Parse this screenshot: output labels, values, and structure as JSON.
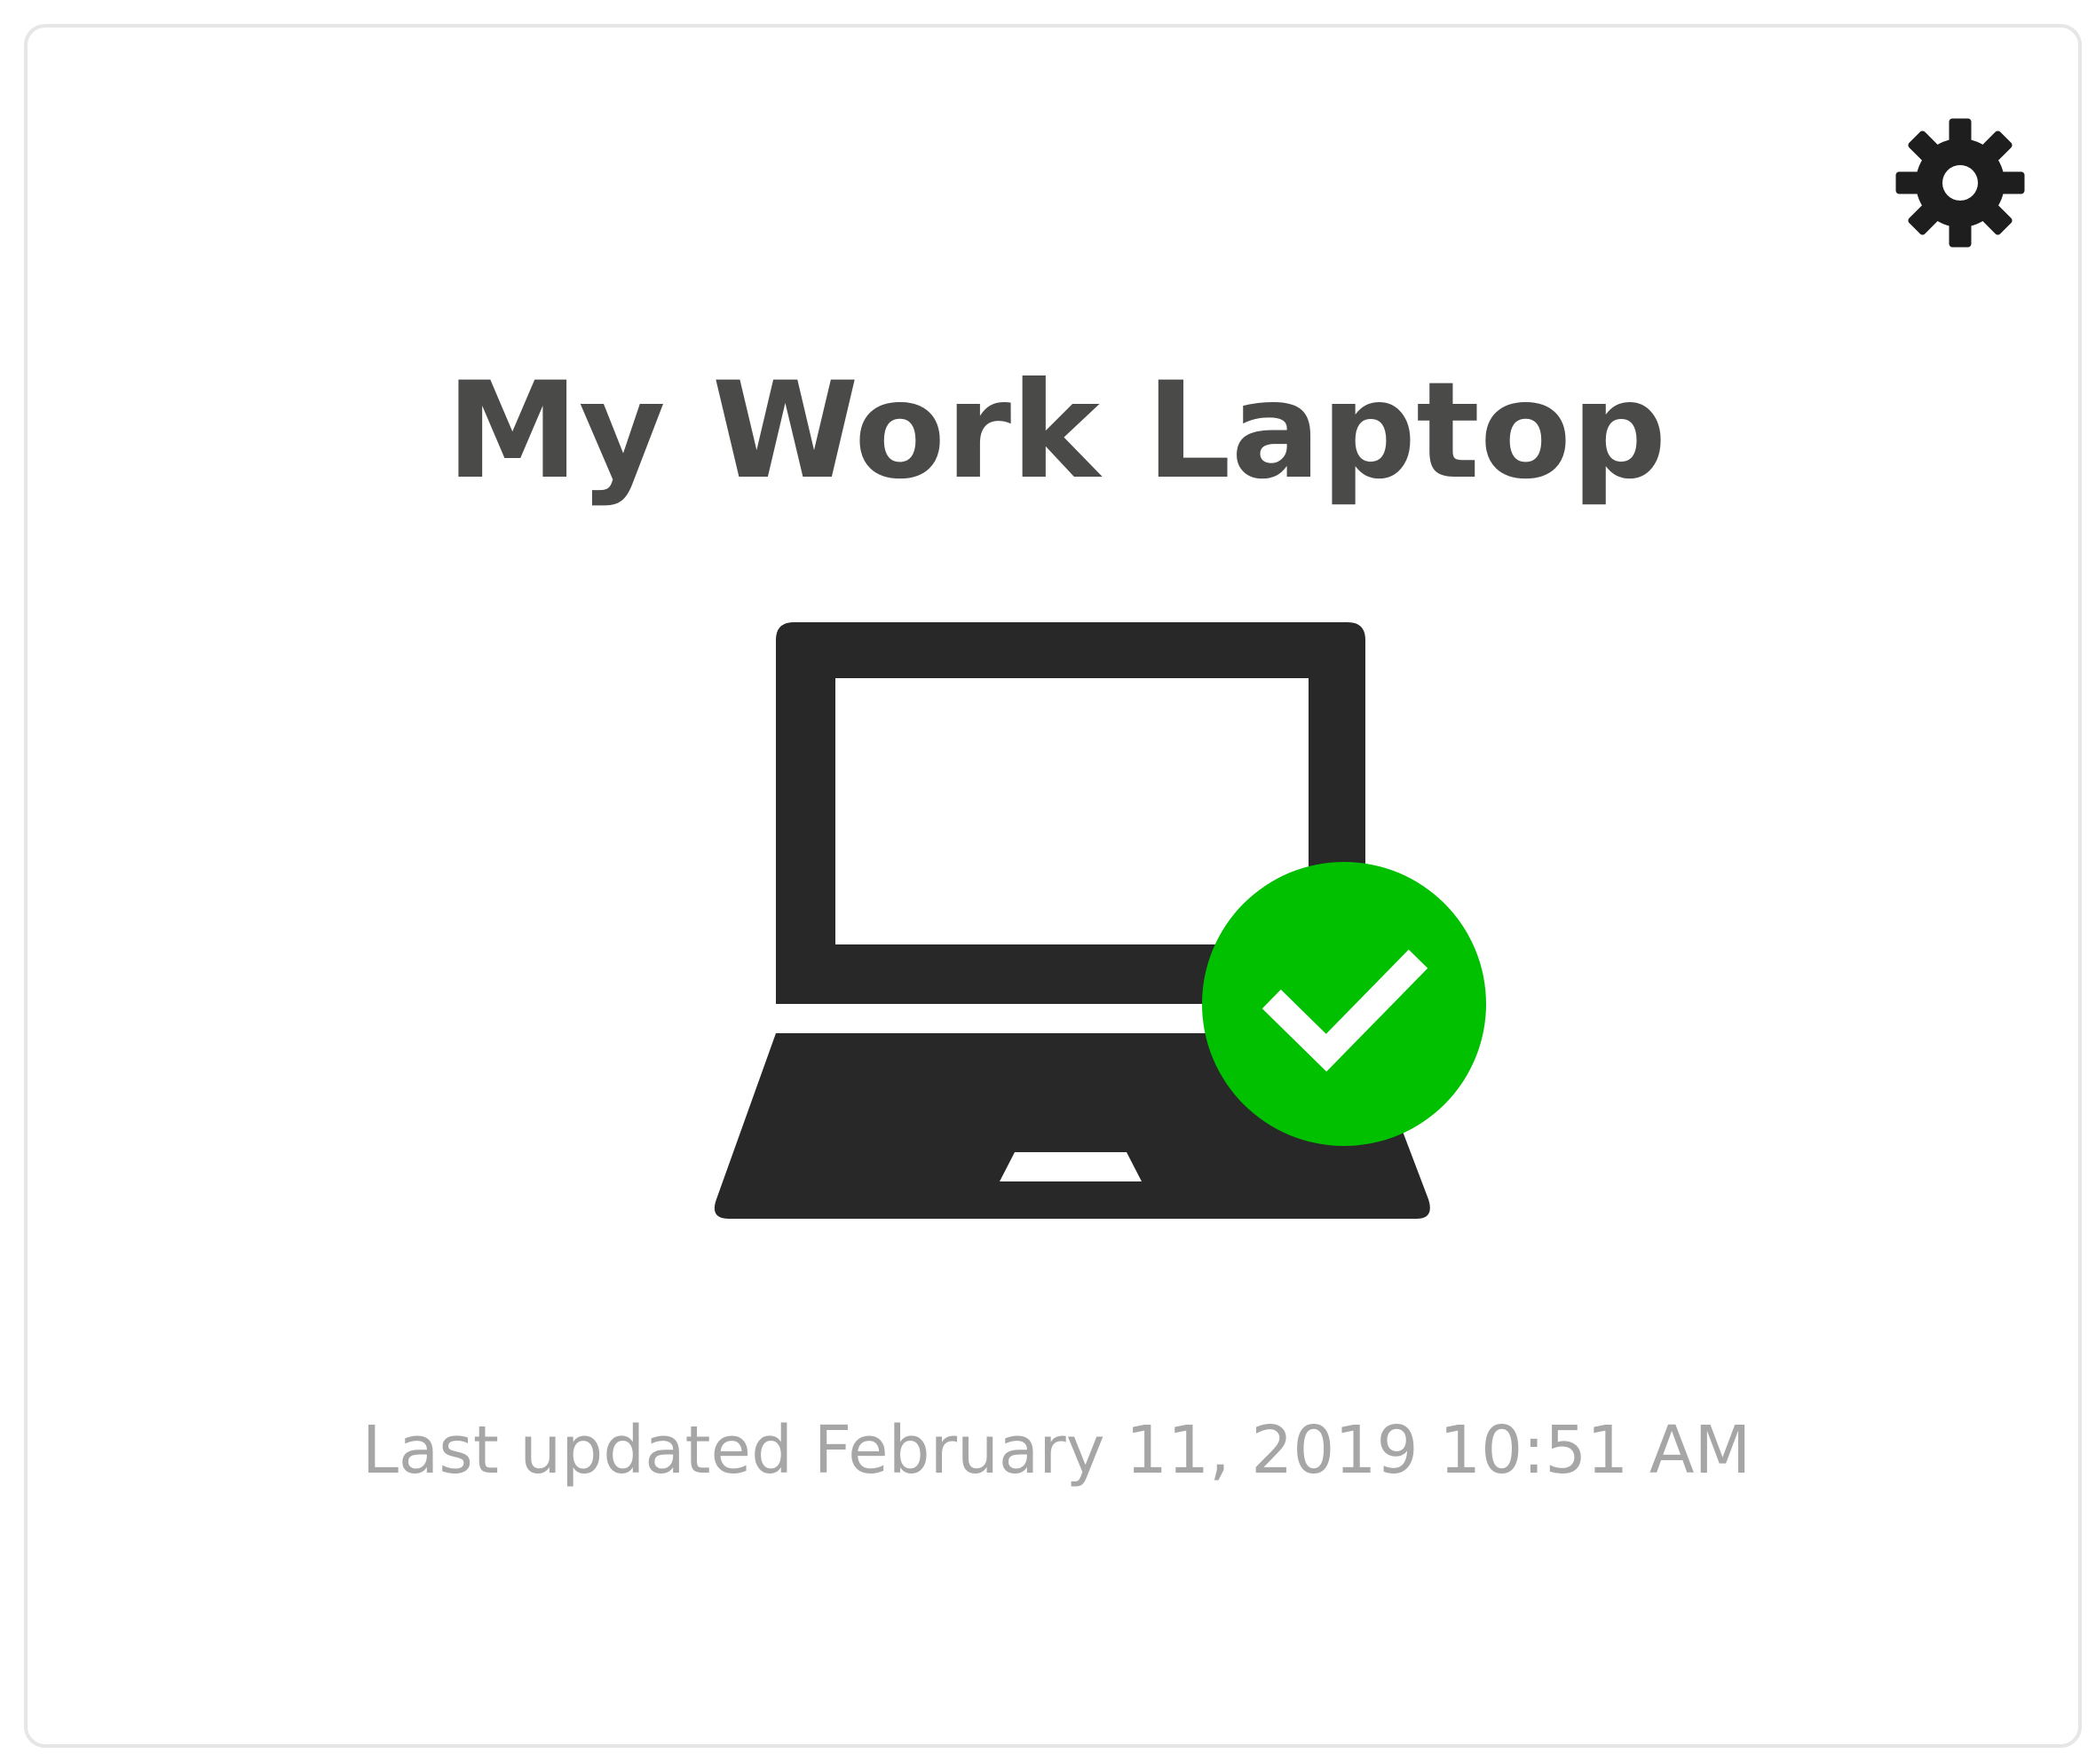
{
  "device_card": {
    "name": "My Work Laptop",
    "last_updated": "Last updated February 11, 2019 10:51 AM",
    "status": "ok",
    "status_icon": "check-icon",
    "device_icon": "laptop-icon",
    "settings_icon": "gear-icon"
  },
  "colors": {
    "title": "#4a4a48",
    "icon_dark": "#282828",
    "status_ok": "#00c000",
    "muted_text": "#a6a6a6",
    "card_border": "#e6e6e6"
  }
}
